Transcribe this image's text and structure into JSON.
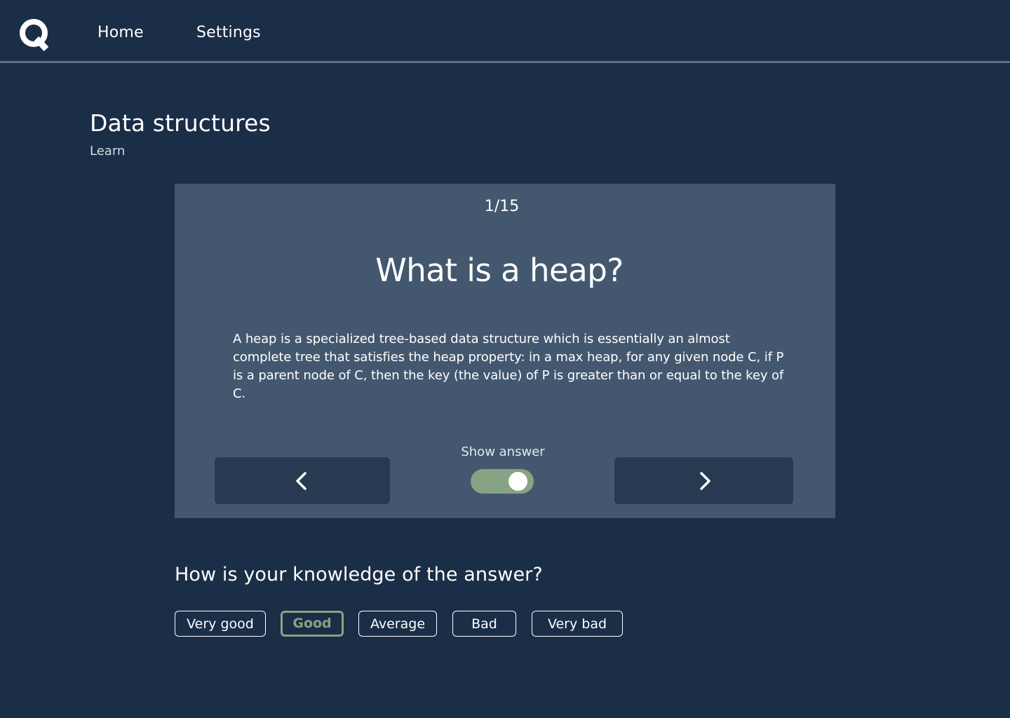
{
  "nav": {
    "logo_icon": "q-logo-icon",
    "links": [
      "Home",
      "Settings"
    ]
  },
  "header": {
    "title": "Data structures",
    "subtitle": "Learn"
  },
  "card": {
    "counter": "1/15",
    "question": "What is a heap?",
    "answer": "A heap is a specialized tree-based data structure which is essentially an almost complete tree that satisfies the heap property: in a max heap, for any given node C, if P is a parent node of C, then the key (the value) of P is greater than or equal to the key of C.",
    "prev_icon": "chevron-left-icon",
    "next_icon": "chevron-right-icon",
    "toggle_label": "Show answer",
    "toggle_on": true
  },
  "rating": {
    "question": "How is your knowledge of the answer?",
    "options": [
      "Very good",
      "Good",
      "Average",
      "Bad",
      "Very bad"
    ],
    "selected": "Good"
  },
  "colors": {
    "background": "#1b2e47",
    "card": "#43586f",
    "button": "#283a51",
    "accent": "#86a384"
  }
}
